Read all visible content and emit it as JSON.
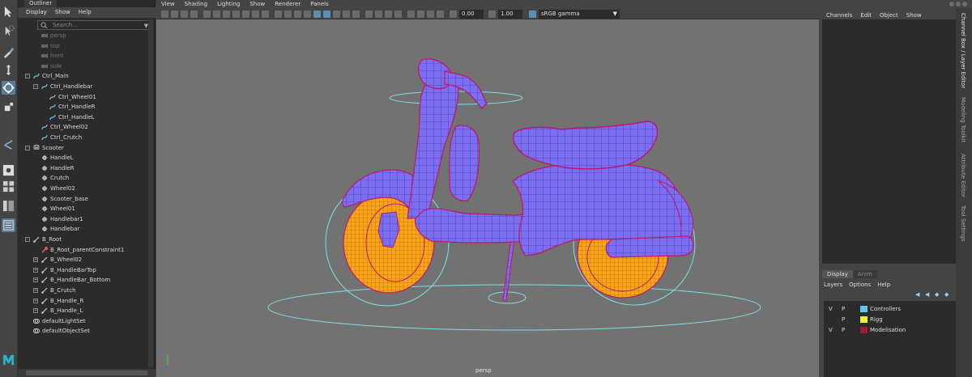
{
  "outliner": {
    "tab_label": "Outliner",
    "menu": [
      "Display",
      "Show",
      "Help"
    ],
    "search_placeholder": "Search...",
    "items": [
      {
        "label": "persp",
        "icon": "camera-icon",
        "depth": 1,
        "dim": true
      },
      {
        "label": "top",
        "icon": "camera-icon",
        "depth": 1,
        "dim": true
      },
      {
        "label": "front",
        "icon": "camera-icon",
        "depth": 1,
        "dim": true
      },
      {
        "label": "side",
        "icon": "camera-icon",
        "depth": 1,
        "dim": true
      },
      {
        "label": "Ctrl_Main",
        "icon": "curve-icon",
        "depth": 0,
        "expand": "-"
      },
      {
        "label": "Ctrl_Handlebar",
        "icon": "curve-icon",
        "depth": 1,
        "expand": "-"
      },
      {
        "label": "Ctrl_Wheel01",
        "icon": "curve-icon",
        "depth": 2
      },
      {
        "label": "Ctrl_HandleR",
        "icon": "curve-icon",
        "depth": 2
      },
      {
        "label": "Ctrl_HandleL",
        "icon": "curve-icon",
        "depth": 2
      },
      {
        "label": "Ctrl_Wheel02",
        "icon": "curve-icon",
        "depth": 1
      },
      {
        "label": "Ctrl_Crutch",
        "icon": "curve-icon",
        "depth": 1
      },
      {
        "label": "Scooter",
        "icon": "group-icon",
        "depth": 0,
        "expand": "-"
      },
      {
        "label": "HandleL",
        "icon": "mesh-icon",
        "depth": 1
      },
      {
        "label": "HandleR",
        "icon": "mesh-icon",
        "depth": 1
      },
      {
        "label": "Crutch",
        "icon": "mesh-icon",
        "depth": 1
      },
      {
        "label": "Wheel02",
        "icon": "mesh-icon",
        "depth": 1
      },
      {
        "label": "Scooter_base",
        "icon": "mesh-icon",
        "depth": 1
      },
      {
        "label": "Wheel01",
        "icon": "mesh-icon",
        "depth": 1
      },
      {
        "label": "Handlebar1",
        "icon": "mesh-icon",
        "depth": 1
      },
      {
        "label": "Handlebar",
        "icon": "mesh-icon",
        "depth": 1
      },
      {
        "label": "B_Root",
        "icon": "joint-icon",
        "depth": 0,
        "expand": "-"
      },
      {
        "label": "B_Root_parentConstraint1",
        "icon": "constraint-icon",
        "depth": 1
      },
      {
        "label": "B_Wheel02",
        "icon": "joint-icon",
        "depth": 1,
        "expand": "+"
      },
      {
        "label": "B_HandleBarTop",
        "icon": "joint-icon",
        "depth": 1,
        "expand": "+"
      },
      {
        "label": "B_HandleBar_Bottom",
        "icon": "joint-icon",
        "depth": 1,
        "expand": "+"
      },
      {
        "label": "B_Crutch",
        "icon": "joint-icon",
        "depth": 1,
        "expand": "+"
      },
      {
        "label": "B_Handle_R",
        "icon": "joint-icon",
        "depth": 1,
        "expand": "+"
      },
      {
        "label": "B_Handle_L",
        "icon": "joint-icon",
        "depth": 1,
        "expand": "+"
      },
      {
        "label": "defaultLightSet",
        "icon": "set-icon",
        "depth": 0
      },
      {
        "label": "defaultObjectSet",
        "icon": "set-icon",
        "depth": 0
      }
    ]
  },
  "viewport": {
    "menu": [
      "View",
      "Shading",
      "Lighting",
      "Show",
      "Renderer",
      "Panels"
    ],
    "exposure_value": "0.00",
    "gamma_value": "1.00",
    "colorspace": "sRGB gamma",
    "camera_label": "persp"
  },
  "channel_box": {
    "menu": [
      "Channels",
      "Edit",
      "Object",
      "Show"
    ]
  },
  "side_tabs": [
    "Channel Box / Layer Editor",
    "Modeling Toolkit",
    "Attribute Editor",
    "Tool Settings"
  ],
  "layer_editor": {
    "tabs": [
      "Display",
      "Anim"
    ],
    "menu": [
      "Layers",
      "Options",
      "Help"
    ],
    "layers": [
      {
        "v": "V",
        "p": "P",
        "name": "Controllers",
        "color": "#5fc8f0"
      },
      {
        "v": "",
        "p": "P",
        "name": "Rigg",
        "color": "#f2ee30"
      },
      {
        "v": "V",
        "p": "P",
        "name": "Modelisation",
        "color": "#9a1d35"
      }
    ]
  },
  "colors": {
    "wire_magenta": "#c0166a",
    "body_purple": "#7d6df0",
    "wheel_orange": "#f2a818",
    "control_cyan": "#7ee0e8",
    "viewport_bg": "#727272"
  }
}
